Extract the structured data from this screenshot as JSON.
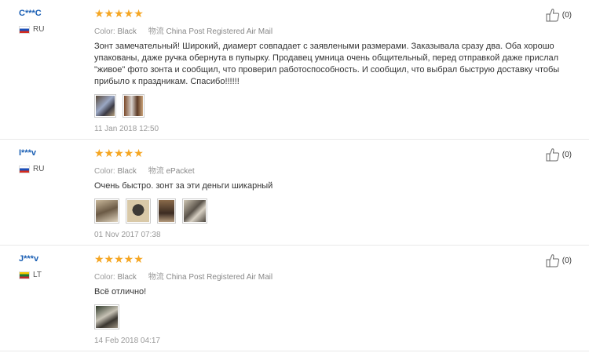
{
  "reviews": [
    {
      "user": "C***C",
      "country": "RU",
      "stars": "★★★★★",
      "color_label": "Color:",
      "color_value": "Black",
      "shipping_label": "物流",
      "shipping_value": "China Post Registered Air Mail",
      "text": "Зонт замечательный! Широкий, диамерт совпадает с заявлеными размерами. Заказывала сразу два. Оба хорошо упакованы, даже ручка обернута в пупырку. Продавец умница очень общительный, перед отправкой даже прислал \"живое\" фото зонта и сообщил, что проверил работоспособность. И сообщил, что выбрал быструю доставку чтобы прибыло к праздникам. Спасибо!!!!!!",
      "date": "11 Jan 2018 12:50",
      "likes": "(0)"
    },
    {
      "user": "I***v",
      "country": "RU",
      "stars": "★★★★★",
      "color_label": "Color:",
      "color_value": "Black",
      "shipping_label": "物流",
      "shipping_value": "ePacket",
      "text": "Очень быстро. зонт за эти деньги шикарный",
      "date": "01 Nov 2017 07:38",
      "likes": "(0)"
    },
    {
      "user": "J***v",
      "country": "LT",
      "stars": "★★★★★",
      "color_label": "Color:",
      "color_value": "Black",
      "shipping_label": "物流",
      "shipping_value": "China Post Registered Air Mail",
      "text": "Всё отлично!",
      "date": "14 Feb 2018 04:17",
      "likes": "(0)"
    }
  ],
  "colors": {
    "star": "#f5a623",
    "username": "#1a5fb4",
    "divider": "#e8e8e8"
  }
}
